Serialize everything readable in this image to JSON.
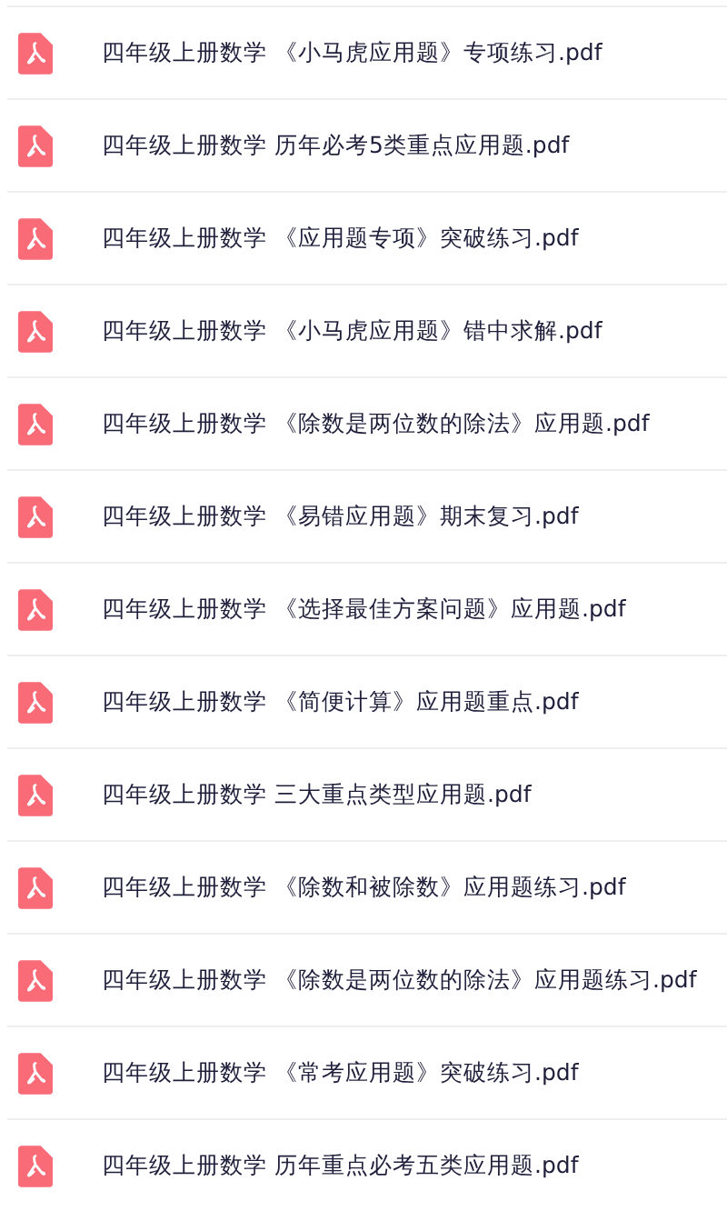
{
  "files": [
    {
      "name": "四年级上册数学 《小马虎应用题》专项练习.pdf"
    },
    {
      "name": "四年级上册数学 历年必考5类重点应用题.pdf"
    },
    {
      "name": "四年级上册数学 《应用题专项》突破练习.pdf"
    },
    {
      "name": "四年级上册数学 《小马虎应用题》错中求解.pdf"
    },
    {
      "name": "四年级上册数学 《除数是两位数的除法》应用题.pdf"
    },
    {
      "name": "四年级上册数学 《易错应用题》期末复习.pdf"
    },
    {
      "name": "四年级上册数学 《选择最佳方案问题》应用题.pdf"
    },
    {
      "name": "四年级上册数学 《简便计算》应用题重点.pdf"
    },
    {
      "name": "四年级上册数学 三大重点类型应用题.pdf"
    },
    {
      "name": "四年级上册数学 《除数和被除数》应用题练习.pdf"
    },
    {
      "name": "四年级上册数学 《除数是两位数的除法》应用题练习.pdf"
    },
    {
      "name": "四年级上册数学 《常考应用题》突破练习.pdf"
    },
    {
      "name": "四年级上册数学 历年重点必考五类应用题.pdf"
    }
  ]
}
